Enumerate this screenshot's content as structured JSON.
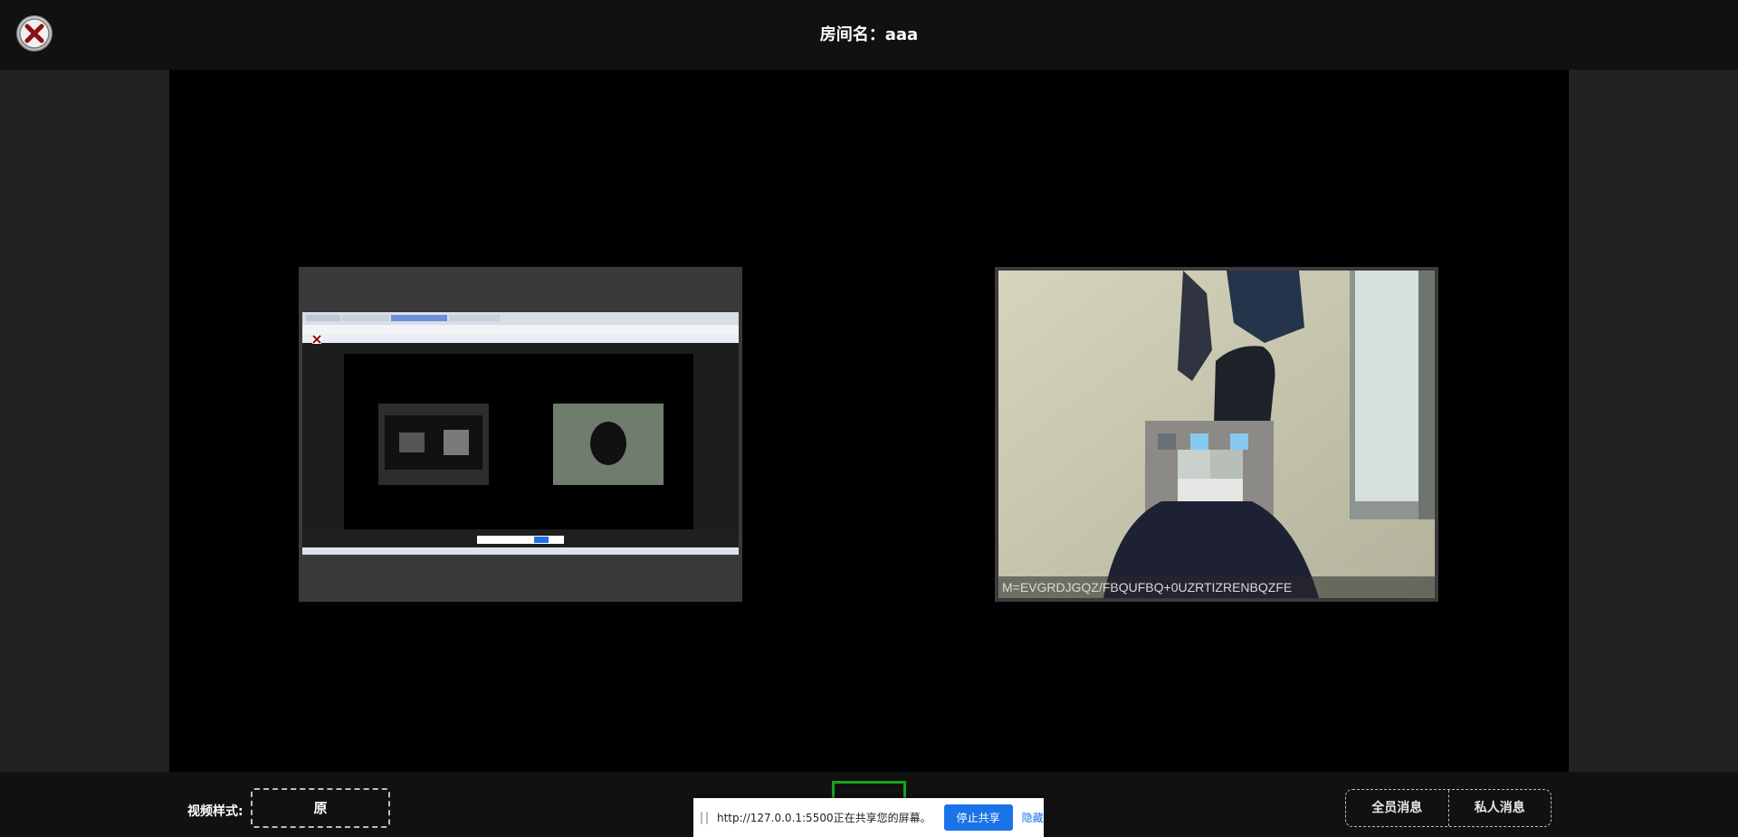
{
  "header": {
    "room_title": "房间名：aaa"
  },
  "videos": {
    "camera_user_id": "M=EVGRDJGQZ/FBQUFBQ+0UZRTIZRENBQZFE"
  },
  "footer": {
    "video_style_label": "视频样式:",
    "video_style_value": "原",
    "all_messages": "全员消息",
    "private_messages": "私人消息"
  },
  "share_notice": {
    "text": "http://127.0.0.1:5500正在共享您的屏幕。",
    "stop_button": "停止共享",
    "hide_link": "隐藏"
  },
  "colors": {
    "accent_green": "#1ba31b",
    "chrome_blue": "#1a73e8",
    "close_red": "#9d1a1a"
  },
  "icons": {
    "close": "close-icon",
    "screen_share": "screen-share-icon"
  }
}
